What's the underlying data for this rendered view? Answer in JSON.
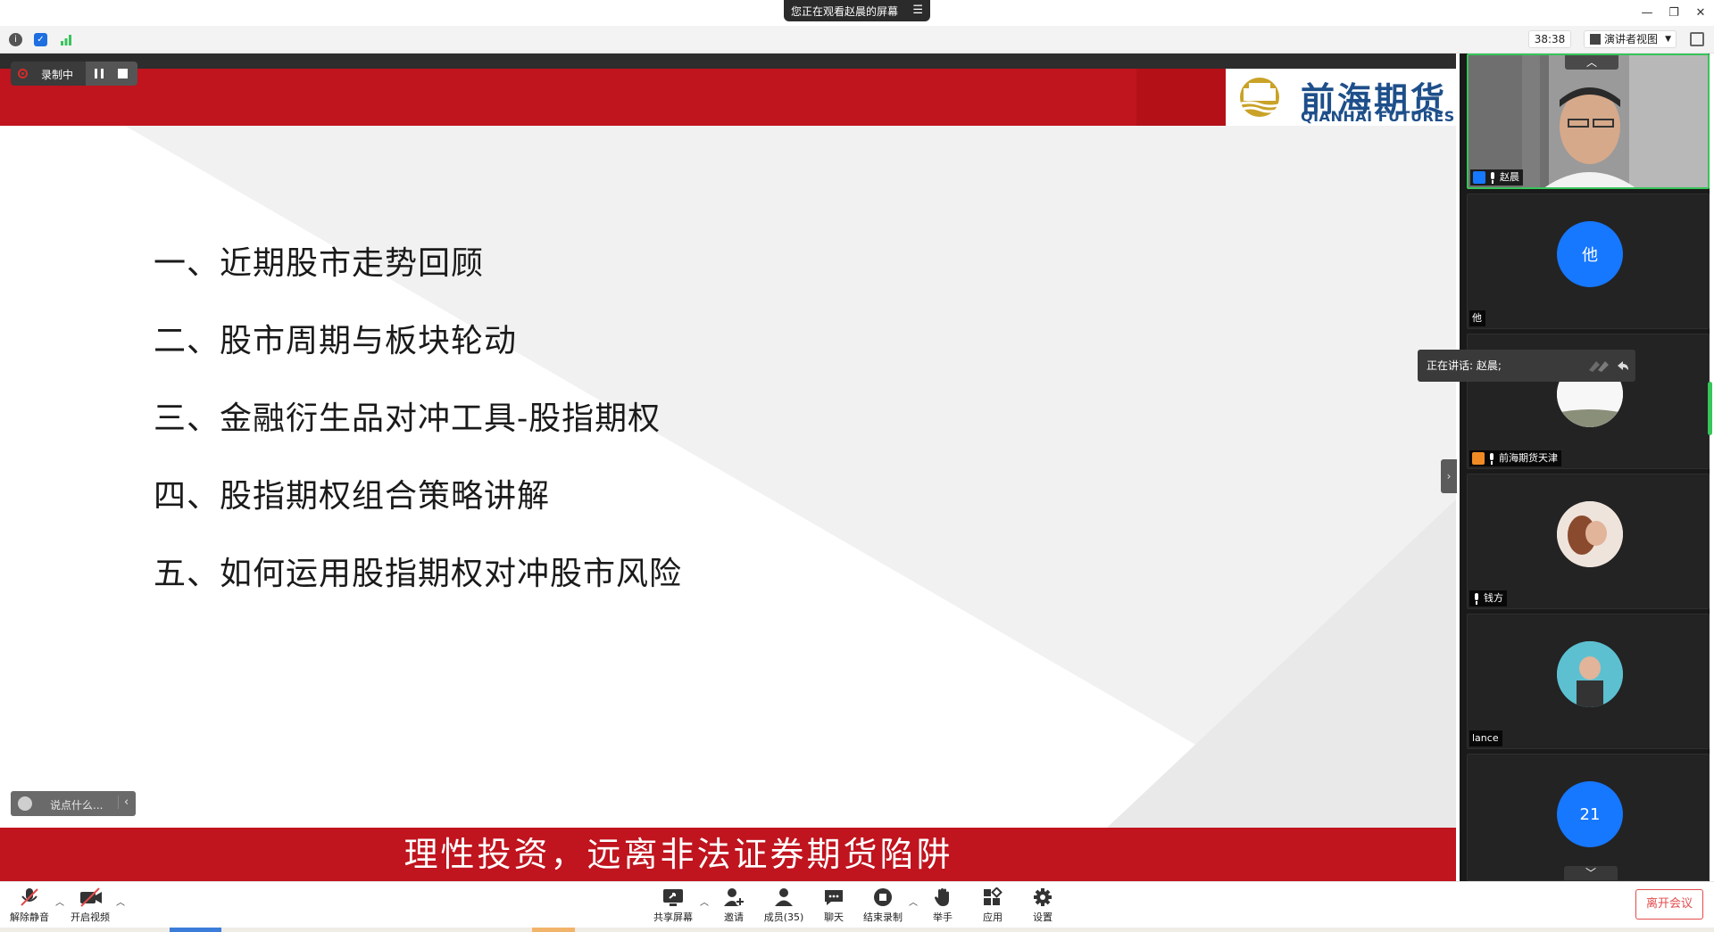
{
  "window": {
    "sharing_banner": "您正在观看赵晨的屏幕"
  },
  "status": {
    "timer": "38:38",
    "view_mode": "演讲者视图"
  },
  "recording": {
    "label": "录制中"
  },
  "slide": {
    "logo_cn": "前海期货",
    "logo_en": "QIANHAI FUTURES",
    "agenda": [
      "一、近期股市走势回顾",
      "二、股市周期与板块轮动",
      "三、金融衍生品对冲工具-股指期权",
      "四、股指期权组合策略讲解",
      "五、如何运用股指期权对冲股市风险"
    ],
    "footer": "理性投资，远离非法证券期货陷阱",
    "colors": {
      "header_red": "#c0141e",
      "logo_blue": "#1e4f8a",
      "logo_gold": "#c9a227"
    }
  },
  "chat_prompt": {
    "placeholder": "说点什么..."
  },
  "gallery": {
    "speaking_tip": "正在讲话: 赵晨;",
    "participants": [
      {
        "name": "赵晨",
        "type": "video"
      },
      {
        "name": "他",
        "initial": "他",
        "avatar_color": "#1677ff"
      },
      {
        "name": "前海期货天津",
        "avatar_color": "#f5f5f5"
      },
      {
        "name": "钱方",
        "avatar_color": "#c98a6a"
      },
      {
        "name": "lance",
        "avatar_color": "#4fb6c9"
      },
      {
        "initial": "21",
        "avatar_color": "#1677ff"
      }
    ]
  },
  "toolbar": {
    "unmute": "解除静音",
    "start_video": "开启视频",
    "share_screen": "共享屏幕",
    "invite": "邀请",
    "members": "成员(35)",
    "chat": "聊天",
    "end_recording": "结束录制",
    "raise_hand": "举手",
    "apps": "应用",
    "settings": "设置",
    "leave": "离开会议"
  }
}
